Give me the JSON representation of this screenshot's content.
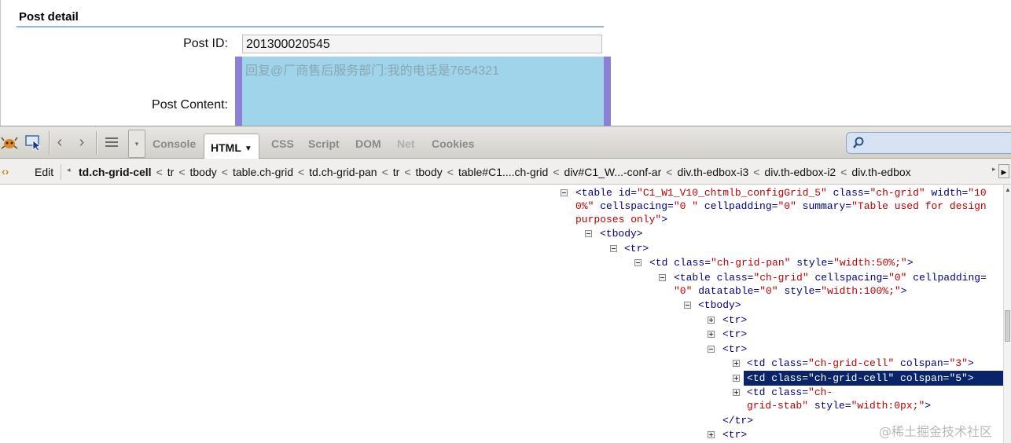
{
  "page": {
    "section_title": "Post detail",
    "post_id_label": "Post ID:",
    "post_id_value": "201300020545",
    "post_content_label": "Post Content:",
    "post_content_value": "回复@厂商售后服务部门:我的电话是7654321"
  },
  "toolbar": {
    "tabs": [
      {
        "label": "Console",
        "active": false
      },
      {
        "label": "HTML",
        "active": true
      },
      {
        "label": "CSS",
        "active": false
      },
      {
        "label": "Script",
        "active": false
      },
      {
        "label": "DOM",
        "active": false
      },
      {
        "label": "Net",
        "active": false
      },
      {
        "label": "Cookies",
        "active": false
      }
    ],
    "icons": [
      "firebug-icon",
      "inspect-icon",
      "back-icon",
      "forward-icon",
      "panel-list-icon",
      "dropdown-icon"
    ],
    "search_placeholder": ""
  },
  "breadcrumb": {
    "edit_label": "Edit",
    "items": [
      "td.ch-grid-cell",
      "tr",
      "tbody",
      "table.ch-grid",
      "td.ch-grid-pan",
      "tr",
      "tbody",
      "table#C1....ch-grid",
      "div#C1_W...-conf-ar",
      "div.th-edbox-i3",
      "div.th-edbox-i2",
      "div.th-edbox"
    ],
    "separator": "<"
  },
  "tree": {
    "r0": {
      "pre": "<table ",
      "a1n": "id=",
      "a1v": "\"C1_W1_V10_chtmlb_configGrid_5\"",
      "a2n": " class=",
      "a2v": "\"ch-grid\"",
      "a3n": " width=",
      "a3v": "\"10"
    },
    "r0b": {
      "a3v": "0%\"",
      "a4n": " cellspacing=",
      "a4v": "\"0 \"",
      "a5n": " cellpadding=",
      "a5v": "\"0\"",
      "a6n": " summary=",
      "a6v": "\"Table used for design"
    },
    "r0c": {
      "a6v": "purposes only\"",
      "post": ">"
    },
    "r1": "<tbody>",
    "r2": "<tr>",
    "r3": {
      "pre": "<td ",
      "a1n": "class=",
      "a1v": "\"ch-grid-pan\"",
      "a2n": " style=",
      "a2v": "\"width:50%;\"",
      "post": ">"
    },
    "r4": {
      "pre": "<table ",
      "a1n": "class=",
      "a1v": "\"ch-grid\"",
      "a2n": " cellspacing=",
      "a2v": "\"0\"",
      "a3n": " cellpadding="
    },
    "r4b": {
      "a3v": "\"0\"",
      "a4n": " datatable=",
      "a4v": "\"0\"",
      "a5n": " style=",
      "a5v": "\"width:100%;\"",
      "post": ">"
    },
    "r5": "<tbody>",
    "r6": "<tr>",
    "r7": "<tr>",
    "r8": "<tr>",
    "r9": {
      "pre": "<td ",
      "a1n": "class=",
      "a1v": "\"ch-grid-cell\"",
      "a2n": " colspan=",
      "a2v": "\"3\"",
      "post": ">"
    },
    "r10": {
      "pre": "<td ",
      "a1n": "class=",
      "a1v": "\"ch-grid-cell\"",
      "a2n": " colspan=",
      "a2v": "\"5\"",
      "post": ">"
    },
    "r11": {
      "pre": "<td ",
      "a1n": "class=",
      "a1v": "\"ch-"
    },
    "r11b": {
      "a1v": "grid-stab\"",
      "a2n": " style=",
      "a2v": "\"width:0px;\"",
      "post": ">"
    },
    "r12": "</tr>",
    "r13": "<tr>"
  },
  "watermark": "@稀土掘金技术社区"
}
